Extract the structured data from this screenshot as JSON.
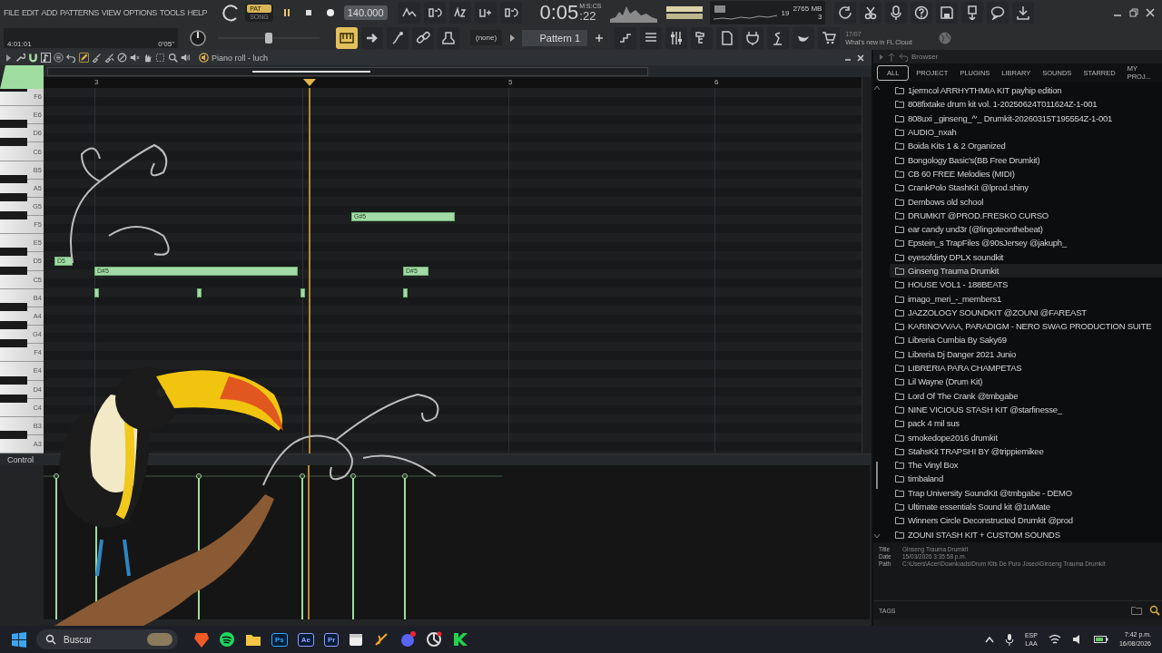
{
  "menu": [
    "FILE",
    "EDIT",
    "ADD",
    "PATTERNS",
    "VIEW",
    "OPTIONS",
    "TOOLS",
    "HELP"
  ],
  "transport": {
    "modes": [
      {
        "label": "PAT",
        "selected": true
      },
      {
        "label": "SONG",
        "selected": false
      }
    ],
    "tempo": "140.000",
    "time": "0:05",
    "time_small": ":22",
    "time_unit": "M:S:CS"
  },
  "monitor": {
    "cpu": "19",
    "memory": "2765 MB",
    "polyphony": "3"
  },
  "hint": {
    "position": "4:01:01",
    "duration": "0'05\""
  },
  "master_pitch": {
    "level": 0.5
  },
  "pattern": {
    "channel": "(none)",
    "name": "Pattern 1"
  },
  "news": {
    "date": "17/07",
    "text": "What's new in FL Cloud"
  },
  "piano_roll": {
    "title": "Piano roll - luch",
    "ruler": [
      "3",
      "5",
      "6"
    ],
    "keys": [
      "F6",
      "E6",
      "D6",
      "C6",
      "B5",
      "A5",
      "G5",
      "F5",
      "E5",
      "D5",
      "C5",
      "B4",
      "A4",
      "G4",
      "F4",
      "E4",
      "D4",
      "C4",
      "B3",
      "A3"
    ],
    "notes": [
      {
        "kind": "note",
        "label": "D5"
      },
      {
        "kind": "note",
        "label": "D#5"
      },
      {
        "kind": "note",
        "label": "G#5"
      },
      {
        "kind": "note",
        "label": "D#5"
      },
      {
        "kind": "stub"
      },
      {
        "kind": "stub"
      },
      {
        "kind": "stub"
      },
      {
        "kind": "stub"
      }
    ],
    "control": "Control"
  },
  "browser": {
    "title": "Browser",
    "tabs": [
      {
        "label": "ALL",
        "selected": true
      },
      {
        "label": "PROJECT",
        "selected": false
      },
      {
        "label": "PLUGINS",
        "selected": false
      },
      {
        "label": "LIBRARY",
        "selected": false
      },
      {
        "label": "SOUNDS",
        "selected": false
      },
      {
        "label": "STARRED",
        "selected": false
      },
      {
        "label": "MY PROJ...",
        "selected": false
      }
    ],
    "items": [
      {
        "label": "1jermcol ARRHYTHMIA KIT payhip edition",
        "selected": false
      },
      {
        "label": "808fixtake drum kit vol. 1-20250624T011624Z-1-001",
        "selected": false
      },
      {
        "label": "808uxi _ginseng_^'_ Drumkit-20260315T195554Z-1-001",
        "selected": false
      },
      {
        "label": "AUDIO_nxah",
        "selected": false
      },
      {
        "label": "Boida Kits 1 & 2 Organized",
        "selected": false
      },
      {
        "label": "Bongology Basic's(BB Free Drumkit)",
        "selected": false
      },
      {
        "label": "CB 60 FREE Melodies (MIDI)",
        "selected": false
      },
      {
        "label": "CrankPolo StashKit @lprod.shiny",
        "selected": false
      },
      {
        "label": "Dembows old school",
        "selected": false
      },
      {
        "label": "DRUMKIT @PROD.FRESKO CURSO",
        "selected": false
      },
      {
        "label": "ear candy und3r (@lingoteonthebeat)",
        "selected": false
      },
      {
        "label": "Epstein_s TrapFiles @90sJersey @jakuph_",
        "selected": false
      },
      {
        "label": "eyesofdirty DPLX soundkit",
        "selected": false
      },
      {
        "label": "Ginseng Trauma Drumkit",
        "selected": true
      },
      {
        "label": "HOUSE VOL1 - 188BEATS",
        "selected": false
      },
      {
        "label": "imago_meri_-_members1",
        "selected": false
      },
      {
        "label": "JAZZOLOGY SOUNDKIT @ZOUNI @FAREAST",
        "selected": false
      },
      {
        "label": "KARINOVVAA, PARADIGM - NERO SWAG PRODUCTION SUITE",
        "selected": false
      },
      {
        "label": "Libreria Cumbia By Saky69",
        "selected": false
      },
      {
        "label": "Libreria Dj Danger 2021 Junio",
        "selected": false
      },
      {
        "label": "LIBRERIA PARA CHAMPETAS",
        "selected": false
      },
      {
        "label": "Lil Wayne (Drum Kit)",
        "selected": false
      },
      {
        "label": "Lord Of The Crank @tmbgabe",
        "selected": false
      },
      {
        "label": "NINE VICIOUS STASH KIT @starfinesse_",
        "selected": false
      },
      {
        "label": "pack 4 mil sus",
        "selected": false
      },
      {
        "label": "smokedope2016 drumkit",
        "selected": false
      },
      {
        "label": "StahsKit TRAPSHI BY @trippiemikee",
        "selected": false
      },
      {
        "label": "The Vinyl Box",
        "selected": false
      },
      {
        "label": "timbaland",
        "selected": false
      },
      {
        "label": "Trap University SoundKit @tmbgabe - DEMO",
        "selected": false
      },
      {
        "label": "Ultimate essentials Sound kit @1uMate",
        "selected": false
      },
      {
        "label": "Winners Circle Deconstructed Drumkit @prod",
        "selected": false
      },
      {
        "label": "ZOUNI STASH KIT + CUSTOM SOUNDS",
        "selected": false
      }
    ],
    "info": [
      {
        "key": "Title",
        "value": "Ginseng Trauma Drumkit"
      },
      {
        "key": "Date",
        "value": "15/03/2026 3:35:58 p.m."
      },
      {
        "key": "Path",
        "value": "C:\\Users\\Acer\\Downloads\\Drum Kits De Puro Joseo\\Ginseng Trauma Drumkit"
      }
    ],
    "tags": "TAGS"
  },
  "taskbar": {
    "search": "Buscar",
    "tiles": [
      {
        "label": "Ps",
        "color": "#31a8ff"
      },
      {
        "label": "Ae",
        "color": "#9999ff"
      },
      {
        "label": "Pr",
        "color": "#9999ff"
      }
    ],
    "language": "ESP",
    "layout": "LAA",
    "time": "7:42 p.m.",
    "date": "16/08/2026"
  }
}
